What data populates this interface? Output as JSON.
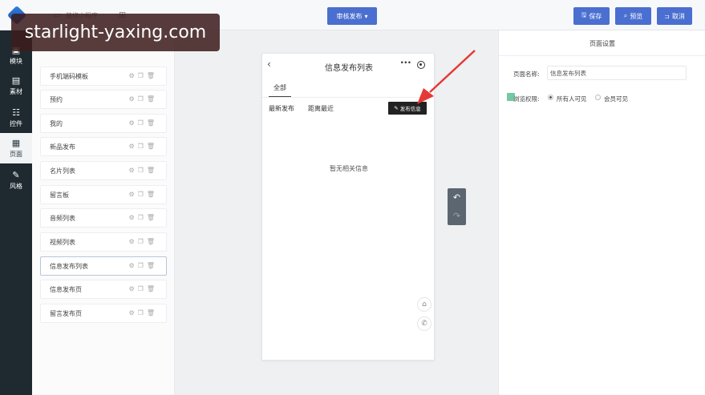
{
  "topbar": {
    "tab_label": "装修小程序",
    "publish_label": "审核发布",
    "save_label": "保存",
    "preview_label": "预览",
    "cancel_label": "取消"
  },
  "watermark": "starlight-yaxing.com",
  "leftnav": [
    {
      "label": "模块",
      "icon": "module-icon"
    },
    {
      "label": "素材",
      "icon": "material-icon"
    },
    {
      "label": "控件",
      "icon": "widget-icon"
    },
    {
      "label": "页面",
      "icon": "page-icon",
      "active": true
    },
    {
      "label": "风格",
      "icon": "style-icon"
    }
  ],
  "panel": {
    "items": [
      "手机端码模板",
      "预约",
      "我的",
      "新品发布",
      "名片列表",
      "留言板",
      "音频列表",
      "视频列表",
      "信息发布列表",
      "信息发布页",
      "留言发布页"
    ],
    "selected_index": 8
  },
  "phone": {
    "title": "信息发布列表",
    "tab_all": "全部",
    "sort_latest": "最新发布",
    "sort_distance": "距离最近",
    "post_button": "发布信息",
    "empty_text": "暂无相关信息"
  },
  "right": {
    "header": "页面设置",
    "page_name_label": "页面名称:",
    "page_name_value": "信息发布列表",
    "access_label": "浏览权限:",
    "access_options": [
      "所有人可见",
      "会员可见"
    ],
    "access_selected": 0
  },
  "colors": {
    "accent": "#4a6fd0",
    "sidebar_dark": "#1f2a30",
    "arrow": "#e53935"
  }
}
